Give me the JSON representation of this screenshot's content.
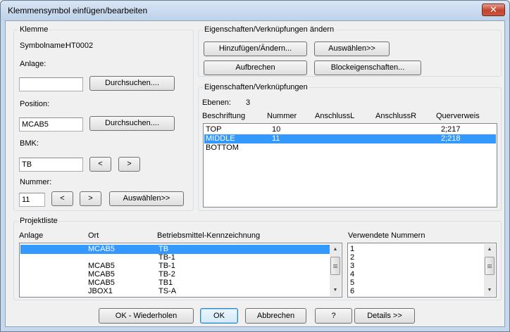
{
  "window": {
    "title": "Klemmensymbol einfügen/bearbeiten",
    "close_glyph": "✕"
  },
  "klemme": {
    "group_label": "Klemme",
    "symbolname_label": "Symbolname:",
    "symbolname_value": "HT0002",
    "anlage_label": "Anlage:",
    "anlage_value": "",
    "browse1_label": "Durchsuchen....",
    "position_label": "Position:",
    "position_value": "MCAB5",
    "browse2_label": "Durchsuchen....",
    "bmk_label": "BMK:",
    "bmk_value": "TB",
    "prev_label": "<",
    "next_label": ">",
    "nummer_label": "Nummer:",
    "nummer_value": "11",
    "nummer_prev_label": "<",
    "nummer_next_label": ">",
    "auswaehlen_label": "Auswählen>>"
  },
  "eigenschaften_aendern": {
    "group_label": "Eigenschaften/Verknüpfungen ändern",
    "add_label": "Hinzufügen/Ändern...",
    "select_label": "Auswählen>>",
    "break_label": "Aufbrechen",
    "block_label": "Blockeigenschaften..."
  },
  "eigenschaften": {
    "group_label": "Eigenschaften/Verknüpfungen",
    "ebenen_label": "Ebenen:",
    "ebenen_value": "3",
    "columns": [
      "Beschriftung",
      "Nummer",
      "AnschlussL",
      "AnschlussR",
      "Querverweis"
    ],
    "rows": [
      {
        "beschriftung": "TOP",
        "nummer": "10",
        "anschlussl": "",
        "anschlussr": "",
        "querverweis": "2;217",
        "selected": false
      },
      {
        "beschriftung": "MIDDLE",
        "nummer": "11",
        "anschlussl": "",
        "anschlussr": "",
        "querverweis": "2;218",
        "selected": true
      },
      {
        "beschriftung": "BOTTOM",
        "nummer": "",
        "anschlussl": "",
        "anschlussr": "",
        "querverweis": "",
        "selected": false
      }
    ]
  },
  "projektliste": {
    "group_label": "Projektliste",
    "columns": [
      "Anlage",
      "Ort",
      "Betriebsmittel-Kennzeichnung"
    ],
    "rows": [
      {
        "anlage": "",
        "ort": "MCAB5",
        "bmk": "TB",
        "selected": true
      },
      {
        "anlage": "",
        "ort": "",
        "bmk": "TB-1",
        "selected": false
      },
      {
        "anlage": "",
        "ort": "MCAB5",
        "bmk": "TB-1",
        "selected": false
      },
      {
        "anlage": "",
        "ort": "MCAB5",
        "bmk": "TB-2",
        "selected": false
      },
      {
        "anlage": "",
        "ort": "MCAB5",
        "bmk": "TB1",
        "selected": false
      },
      {
        "anlage": "",
        "ort": "JBOX1",
        "bmk": "TS-A",
        "selected": false
      }
    ],
    "used_numbers_label": "Verwendete Nummern",
    "used_numbers": [
      "1",
      "2",
      "3",
      "4",
      "5",
      "6"
    ]
  },
  "footer": {
    "ok_repeat_label": "OK - Wiederholen",
    "ok_label": "OK",
    "cancel_label": "Abbrechen",
    "help_label": "?",
    "details_label": "Details >>"
  },
  "colors": {
    "selection": "#3399ff",
    "title_bar": "#c5d8ec",
    "close_button": "#c0442b"
  }
}
